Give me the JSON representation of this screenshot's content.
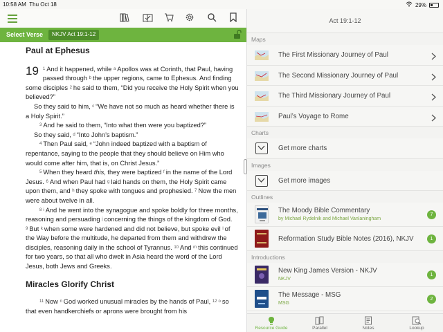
{
  "status": {
    "time": "10:58 AM",
    "date": "Thu Oct 18",
    "battery": "29%"
  },
  "toolbar": {
    "icons": [
      "menu-icon",
      "library-icon",
      "reading-plan-icon",
      "cart-icon",
      "settings-icon",
      "search-icon",
      "bookmark-icon"
    ]
  },
  "select_bar": {
    "label": "Select Verse",
    "reference": "NKJV Act 19:1-12"
  },
  "bible": {
    "heading1": "Paul at Ephesus",
    "chapter": "19",
    "p1_v1": "1",
    "p1_text1": "And it happened, while",
    "p1_cr_a": "a",
    "p1_text2": "Apollos was at Corinth, that Paul, having passed through",
    "p1_cr_b": "b",
    "p1_text3": "the upper regions, came to Ephesus. And finding some disciples",
    "p1_v2": "2",
    "p1_text4": "he said to them, “Did you receive the Holy Spirit when you believed?”",
    "p2_text1": "So they said to him,",
    "p2_cr_c": "c",
    "p2_text2": "“We have not so much as heard whether there is a Holy Spirit.”",
    "p3_v3": "3",
    "p3_text1": "And he said to them, “Into what then were you baptized?”",
    "p4_text1": "So they said,",
    "p4_cr_d": "d",
    "p4_text2": "“Into John’s baptism.”",
    "p5_v4": "4",
    "p5_text1": "Then Paul said,",
    "p5_cr_e": "e",
    "p5_text2": "“John indeed baptized with a baptism of repentance, saying to the people that they should believe on Him who would come after him, that is, on Christ Jesus.”",
    "p6_v5": "5",
    "p6_text1": "When they heard",
    "p6_this": "this,",
    "p6_text2": "they were baptized",
    "p6_cr_f": "f",
    "p6_text3": "in the name of the Lord Jesus.",
    "p6_v6": "6",
    "p6_text4": "And when Paul had",
    "p6_cr_g": "g",
    "p6_text5": "laid hands on them, the Holy Spirit came upon them, and",
    "p6_cr_h": "h",
    "p6_text6": "they spoke with tongues and prophesied.",
    "p6_v7": "7",
    "p6_text7": "Now the men were about twelve in all.",
    "p7_v8": "8",
    "p7_cr_i": "i",
    "p7_text1": "And he went into the synagogue and spoke boldly for three months, reasoning and persuading",
    "p7_cr_j": "j",
    "p7_text2": "concerning the things of the kingdom of God.",
    "p7_v9": "9",
    "p7_text3": "But",
    "p7_cr_k": "k",
    "p7_text4": "when some were hardened and did not believe, but spoke evil",
    "p7_cr_l": "l",
    "p7_text5": "of the Way before the multitude, he departed from them and withdrew the disciples, reasoning daily in the school of Tyrannus.",
    "p7_v10": "10",
    "p7_text6": "And",
    "p7_cr_m": "m",
    "p7_text7": "this continued for two years, so that all who dwelt in Asia heard the word of the Lord Jesus, both Jews and Greeks.",
    "heading2": "Miracles Glorify Christ",
    "p8_v11": "11",
    "p8_text1": "Now",
    "p8_cr_n": "n",
    "p8_text2": "God worked unusual miracles by the hands of Paul,",
    "p8_v12": "12",
    "p8_cr_o": "o",
    "p8_text3": "so that even handkerchiefs or aprons were brought from his"
  },
  "resource_guide": {
    "header": "Act 19:1-12",
    "maps_label": "Maps",
    "maps": [
      {
        "label": "The First Missionary Journey of Paul"
      },
      {
        "label": "The Second Missionary Journey of Paul"
      },
      {
        "label": "The Third Missionary Journey of Paul"
      },
      {
        "label": "Paul’s Voyage to Rome"
      }
    ],
    "charts_label": "Charts",
    "charts_action": "Get more charts",
    "images_label": "Images",
    "images_action": "Get more images",
    "outlines_label": "Outlines",
    "outlines": [
      {
        "title": "The Moody Bible Commentary",
        "sub": "by Michael Rydelnik and Michael Vanlaningham",
        "count": "7"
      },
      {
        "title": "Reformation Study Bible Notes (2016), NKJV",
        "count": "1"
      }
    ],
    "introductions_label": "Introductions",
    "introductions": [
      {
        "title": "New King James Version - NKJV",
        "sub": "NKJV",
        "count": "1"
      },
      {
        "title": "The Message - MSG",
        "sub": "MSG",
        "count": "2"
      }
    ]
  },
  "tabs": [
    {
      "label": "Resource Guide",
      "icon": "lightbulb-icon",
      "active": true
    },
    {
      "label": "Parallel",
      "icon": "books-icon",
      "active": false
    },
    {
      "label": "Notes",
      "icon": "notes-icon",
      "active": false
    },
    {
      "label": "Lookup",
      "icon": "lookup-icon",
      "active": false
    }
  ],
  "colors": {
    "accent": "#6eb43f",
    "accent_dark": "#4e8d2b",
    "badge": "#6eb43f"
  }
}
